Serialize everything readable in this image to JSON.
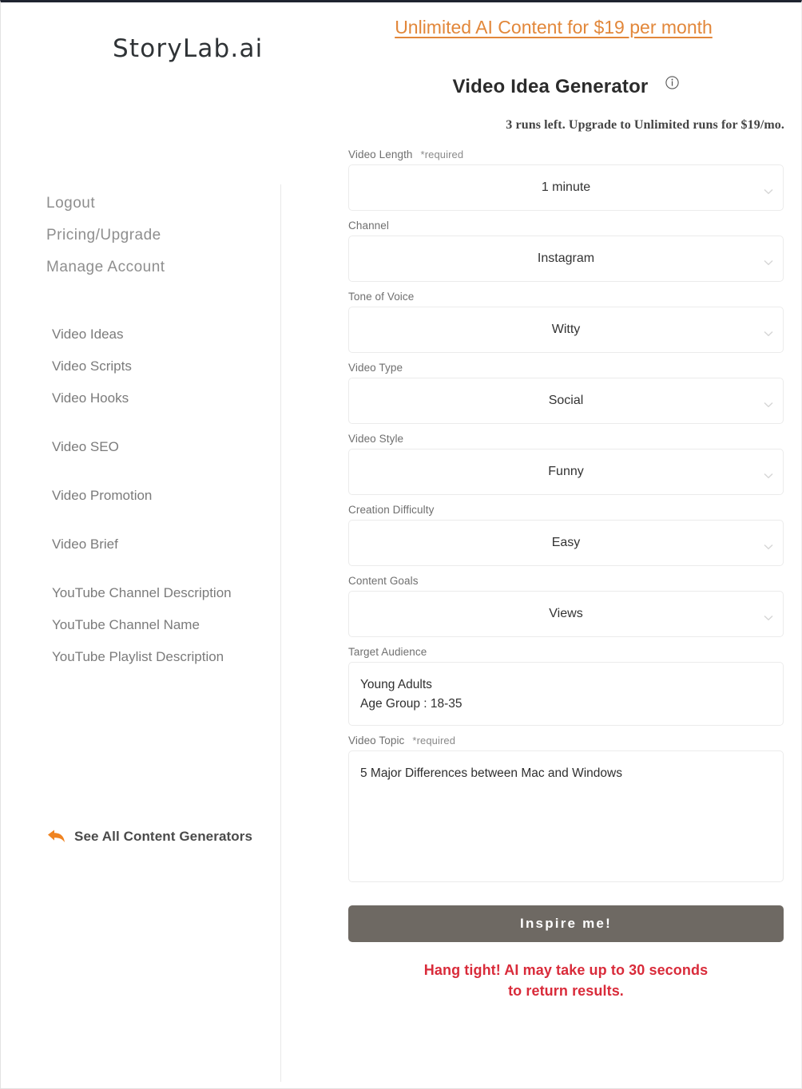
{
  "header": {
    "logo": "StoryLab.ai",
    "promo_link": "Unlimited AI Content for $19 per month",
    "title": "Video Idea Generator",
    "info_icon": "info-circle-icon",
    "runs_left": "3 runs left. Upgrade to Unlimited runs for $19/mo."
  },
  "sidebar": {
    "account_items": [
      {
        "label": "Logout"
      },
      {
        "label": "Pricing/Upgrade"
      },
      {
        "label": "Manage Account"
      }
    ],
    "nav_items": [
      {
        "label": "Video Ideas"
      },
      {
        "label": "Video Scripts"
      },
      {
        "label": "Video Hooks"
      },
      {
        "label": "Video SEO"
      },
      {
        "label": "Video Promotion"
      },
      {
        "label": "Video Brief"
      },
      {
        "label": "YouTube Channel Description"
      },
      {
        "label": "YouTube Channel Name"
      },
      {
        "label": "YouTube Playlist Description"
      }
    ],
    "see_all": {
      "icon": "back-arrow-icon",
      "label": "See All Content Generators"
    }
  },
  "form": {
    "required_marker": "*required",
    "fields": [
      {
        "label": "Video Length",
        "required": true,
        "value": "1 minute",
        "type": "select"
      },
      {
        "label": "Channel",
        "required": false,
        "value": "Instagram",
        "type": "select"
      },
      {
        "label": "Tone of Voice",
        "required": false,
        "value": "Witty",
        "type": "select"
      },
      {
        "label": "Video Type",
        "required": false,
        "value": "Social",
        "type": "select"
      },
      {
        "label": "Video Style",
        "required": false,
        "value": "Funny",
        "type": "select"
      },
      {
        "label": "Creation Difficulty",
        "required": false,
        "value": "Easy",
        "type": "select"
      },
      {
        "label": "Content Goals",
        "required": false,
        "value": "Views",
        "type": "select"
      }
    ],
    "target_audience": {
      "label": "Target Audience",
      "line1": "Young Adults",
      "line2": "Age Group : 18-35"
    },
    "video_topic": {
      "label": "Video Topic",
      "required": true,
      "value": "5 Major Differences between Mac and Windows"
    },
    "submit_label": "Inspire me!",
    "notice_line1": "Hang tight! AI may take up to 30 seconds",
    "notice_line2": "to return results."
  },
  "colors": {
    "accent_orange": "#e2873a",
    "notice_red": "#d92b3a",
    "button_grey": "#6e6963"
  }
}
